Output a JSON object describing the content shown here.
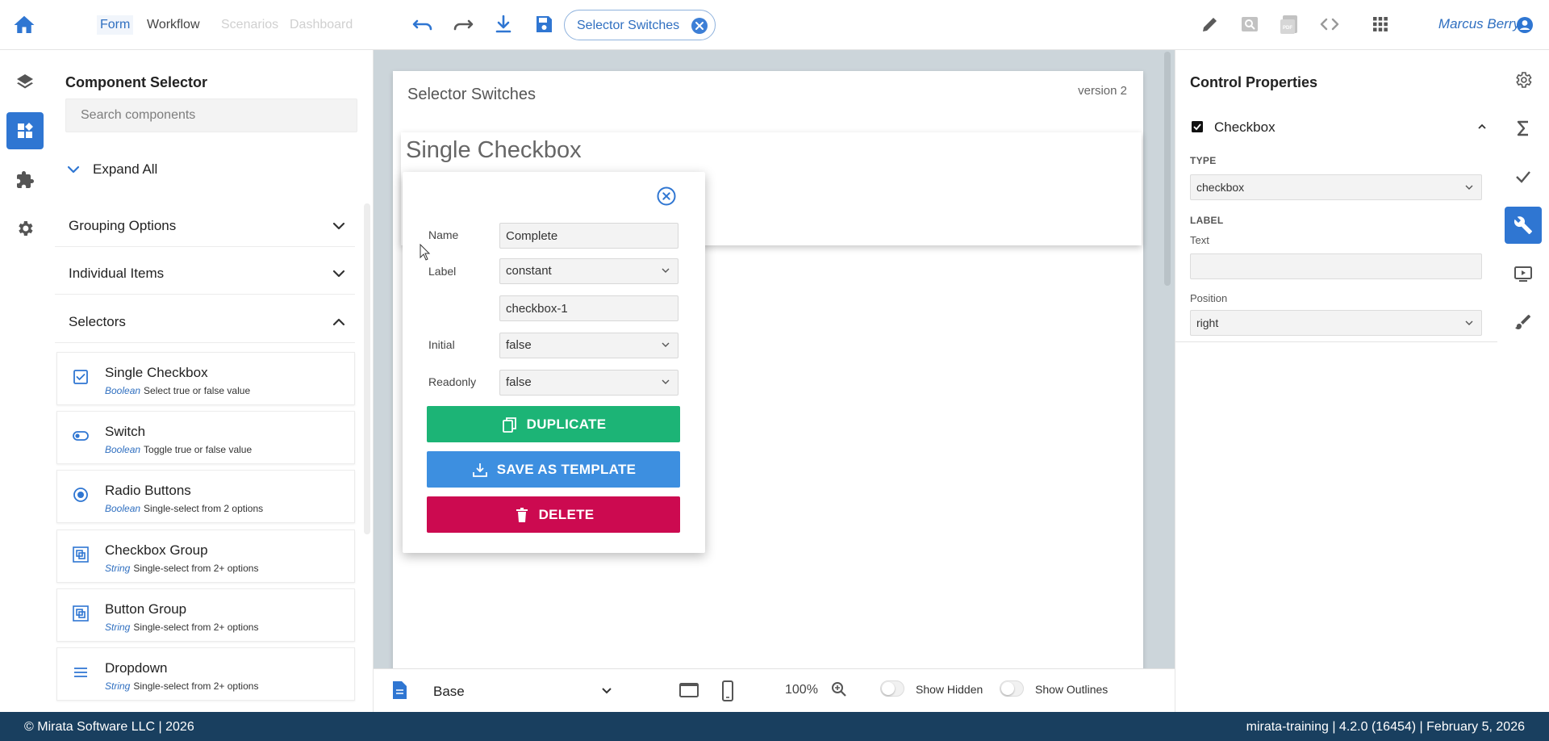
{
  "header": {
    "tabs": [
      {
        "label": "Form",
        "active": true
      },
      {
        "label": "Workflow",
        "active": false
      },
      {
        "label": "Scenarios",
        "faded": true
      },
      {
        "label": "Dashboard",
        "faded": true
      }
    ],
    "chip_label": "Selector Switches",
    "user_name": "Marcus Berry",
    "icons": [
      "home-icon",
      "undo-icon",
      "redo-icon",
      "download-icon",
      "save-icon",
      "pencil-icon",
      "preview-icon",
      "pdf-icon",
      "code-icon",
      "apps-grid-icon",
      "account-icon"
    ]
  },
  "left_rail": {
    "icons": [
      "layers-icon",
      "dashboard-icon",
      "puzzle-icon",
      "gear-icon"
    ],
    "active_index": 1
  },
  "component_selector": {
    "title": "Component Selector",
    "search_placeholder": "Search components",
    "expand_all_label": "Expand All",
    "groups": [
      {
        "label": "Grouping Options",
        "expanded": false
      },
      {
        "label": "Individual Items",
        "expanded": false
      },
      {
        "label": "Selectors",
        "expanded": true
      }
    ],
    "items": [
      {
        "name": "Single Checkbox",
        "type": "Boolean",
        "desc": "Select true or false value",
        "icon": "checkbox-icon"
      },
      {
        "name": "Switch",
        "type": "Boolean",
        "desc": "Toggle true or false value",
        "icon": "toggle-icon"
      },
      {
        "name": "Radio Buttons",
        "type": "Boolean",
        "desc": "Single-select from 2 options",
        "icon": "radio-icon"
      },
      {
        "name": "Checkbox Group",
        "type": "String",
        "desc": "Single-select from 2+ options",
        "icon": "checkbox-group-icon"
      },
      {
        "name": "Button Group",
        "type": "String",
        "desc": "Single-select from 2+ options",
        "icon": "button-group-icon"
      },
      {
        "name": "Dropdown",
        "type": "String",
        "desc": "Single-select from 2+ options",
        "icon": "list-icon"
      }
    ]
  },
  "canvas": {
    "form_title": "Selector Switches",
    "version": "version 2",
    "control_title": "Single Checkbox",
    "popup": {
      "name_label": "Name",
      "name_value": "Complete",
      "label_label": "Label",
      "label_mode": "constant",
      "label_value": "checkbox-1",
      "initial_label": "Initial",
      "initial_value": "false",
      "readonly_label": "Readonly",
      "readonly_value": "false",
      "duplicate_label": "DUPLICATE",
      "template_label": "SAVE AS TEMPLATE",
      "delete_label": "DELETE"
    },
    "bottom": {
      "page_select": "Base",
      "zoom": "100%",
      "show_hidden_label": "Show Hidden",
      "show_outlines_label": "Show Outlines"
    }
  },
  "properties": {
    "title": "Control Properties",
    "section_label": "Checkbox",
    "type_caption": "TYPE",
    "type_value": "checkbox",
    "label_caption": "LABEL",
    "text_label": "Text",
    "text_value": "",
    "position_label": "Position",
    "position_value": "right"
  },
  "right_rail": {
    "icons": [
      "settings-icon",
      "sigma-icon",
      "check-icon",
      "wrench-icon",
      "preview-play-icon",
      "brush-icon"
    ],
    "active_index": 3
  },
  "footer": {
    "left": "© Mirata Software LLC | 2026",
    "right": "mirata-training | 4.2.0 (16454) | February 5, 2026"
  },
  "colors": {
    "accent": "#2f76d2",
    "duplicate": "#1cb476",
    "template": "#3d8fe0",
    "delete": "#cc0a50",
    "footer": "#193f5f",
    "canvas_bg": "#ccd5da"
  }
}
